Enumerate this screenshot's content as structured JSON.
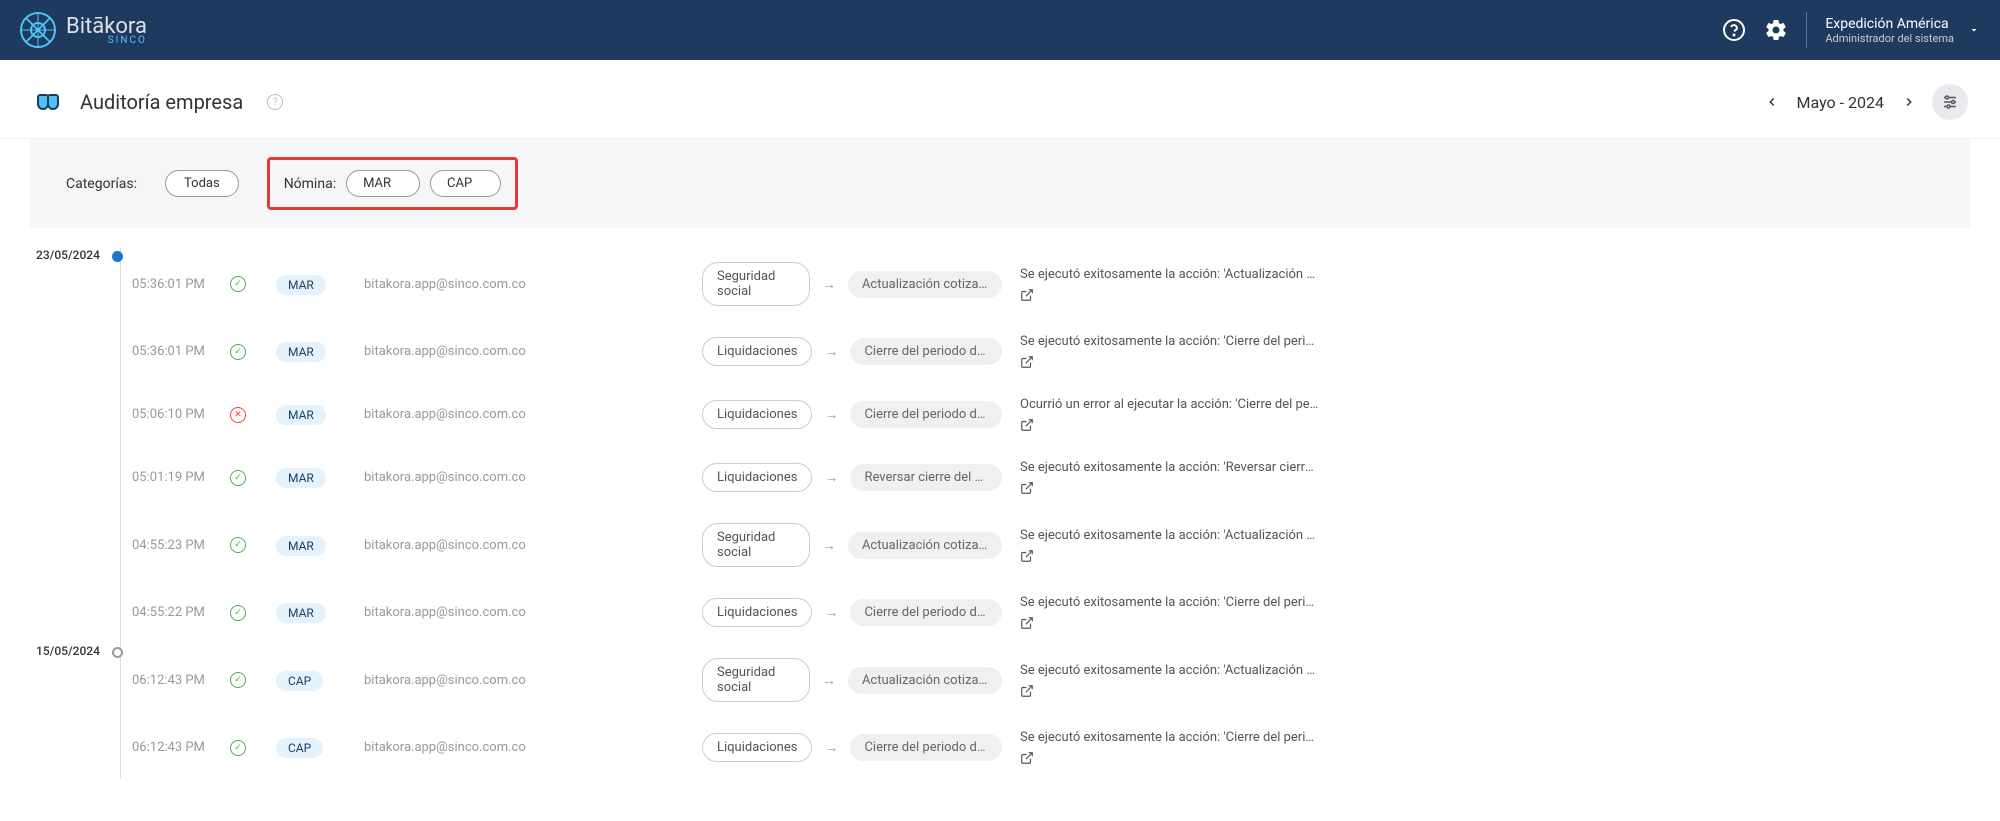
{
  "header": {
    "logo_text": "Bitākora",
    "logo_sub": "SINCO",
    "user_name": "Expedición América",
    "user_role": "Administrador del sistema"
  },
  "page": {
    "title": "Auditoría empresa",
    "period": "Mayo - 2024"
  },
  "filters": {
    "categorias_label": "Categorías:",
    "categorias_all": "Todas",
    "nomina_label": "Nómina:",
    "nomina_chips": [
      "MAR",
      "CAP"
    ]
  },
  "dates": [
    {
      "label": "23/05/2024",
      "filled": true,
      "entries": [
        {
          "time": "05:36:01 PM",
          "status": "success",
          "tag": "MAR",
          "user": "bitakora.app@sinco.com.co",
          "category": "Seguridad social",
          "result": "Actualización cotizantes ...",
          "description": "Se ejecutó exitosamente la acción: 'Actualización cotiza..."
        },
        {
          "time": "05:36:01 PM",
          "status": "success",
          "tag": "MAR",
          "user": "bitakora.app@sinco.com.co",
          "category": "Liquidaciones",
          "result": "Cierre del periodo de nóm...",
          "description": "Se ejecutó exitosamente la acción: 'Cierre del periodo d..."
        },
        {
          "time": "05:06:10 PM",
          "status": "error",
          "tag": "MAR",
          "user": "bitakora.app@sinco.com.co",
          "category": "Liquidaciones",
          "result": "Cierre del periodo de nóm...",
          "description": "Ocurrió un error al ejecutar la acción: 'Cierre del periodo ..."
        },
        {
          "time": "05:01:19 PM",
          "status": "success",
          "tag": "MAR",
          "user": "bitakora.app@sinco.com.co",
          "category": "Liquidaciones",
          "result": "Reversar cierre del period...",
          "description": "Se ejecutó exitosamente la acción: 'Reversar cierre del p..."
        },
        {
          "time": "04:55:23 PM",
          "status": "success",
          "tag": "MAR",
          "user": "bitakora.app@sinco.com.co",
          "category": "Seguridad social",
          "result": "Actualización cotizantes ...",
          "description": "Se ejecutó exitosamente la acción: 'Actualización cotiza..."
        },
        {
          "time": "04:55:22 PM",
          "status": "success",
          "tag": "MAR",
          "user": "bitakora.app@sinco.com.co",
          "category": "Liquidaciones",
          "result": "Cierre del periodo de nóm...",
          "description": "Se ejecutó exitosamente la acción: 'Cierre del periodo d..."
        }
      ]
    },
    {
      "label": "15/05/2024",
      "filled": false,
      "entries": [
        {
          "time": "06:12:43 PM",
          "status": "success",
          "tag": "CAP",
          "user": "bitakora.app@sinco.com.co",
          "category": "Seguridad social",
          "result": "Actualización cotizantes ...",
          "description": "Se ejecutó exitosamente la acción: 'Actualización cotiza..."
        },
        {
          "time": "06:12:43 PM",
          "status": "success",
          "tag": "CAP",
          "user": "bitakora.app@sinco.com.co",
          "category": "Liquidaciones",
          "result": "Cierre del periodo de nóm...",
          "description": "Se ejecutó exitosamente la acción: 'Cierre del periodo d..."
        }
      ]
    }
  ]
}
